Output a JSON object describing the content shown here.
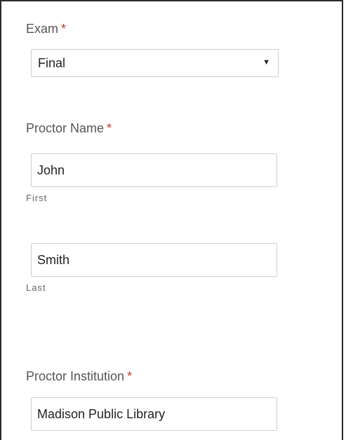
{
  "exam": {
    "label": "Exam",
    "required_mark": "*",
    "selected": "Final",
    "caret": "▼"
  },
  "proctor_name": {
    "label": "Proctor Name",
    "required_mark": "*",
    "first_value": "John",
    "first_sublabel": "First",
    "last_value": "Smith",
    "last_sublabel": "Last"
  },
  "proctor_institution": {
    "label": "Proctor Institution",
    "required_mark": "*",
    "value": "Madison Public Library"
  },
  "colors": {
    "required": "#c0392b",
    "label": "#555555",
    "border": "#cfcfcf"
  }
}
